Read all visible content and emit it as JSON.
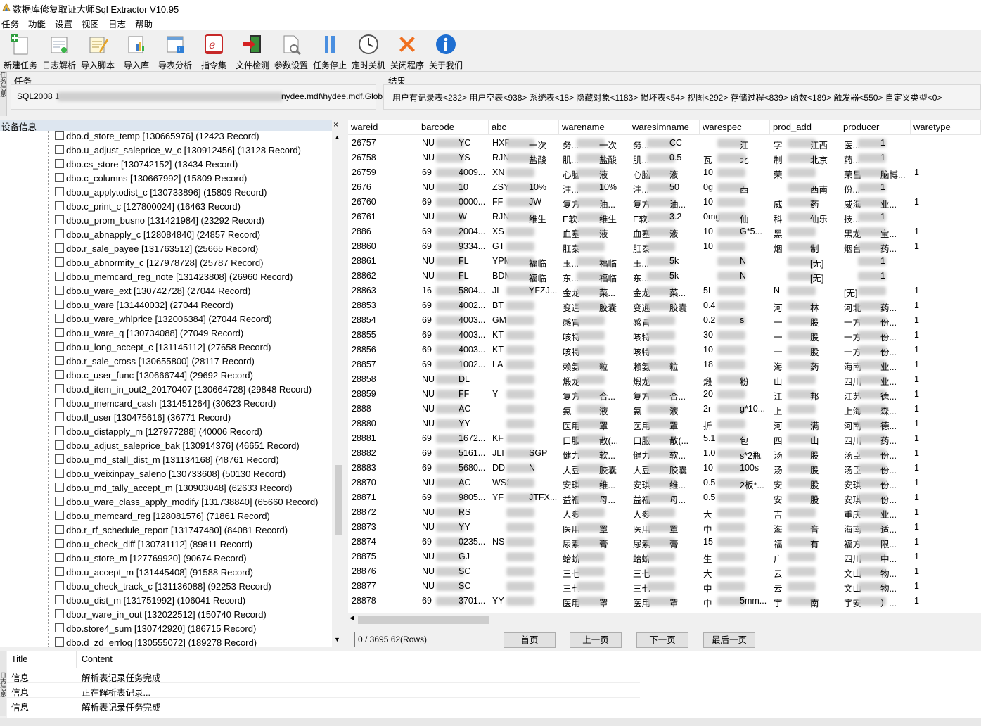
{
  "window": {
    "title": "数据库修复取证大师Sql Extractor V10.95"
  },
  "menu": [
    "任务",
    "功能",
    "设置",
    "视图",
    "日志",
    "帮助"
  ],
  "toolbar": [
    {
      "label": "新建任务",
      "icon": "new-task-icon"
    },
    {
      "label": "日志解析",
      "icon": "log-parse-icon"
    },
    {
      "label": "导入脚本",
      "icon": "import-script-icon"
    },
    {
      "label": "导入库",
      "icon": "import-db-icon"
    },
    {
      "label": "导表分析",
      "icon": "table-analysis-icon"
    },
    {
      "label": "指令集",
      "icon": "command-set-icon"
    },
    {
      "label": "文件检测",
      "icon": "file-check-icon"
    },
    {
      "label": "参数设置",
      "icon": "param-settings-icon"
    },
    {
      "label": "任务停止",
      "icon": "pause-icon"
    },
    {
      "label": "定时关机",
      "icon": "clock-icon"
    },
    {
      "label": "关闭程序",
      "icon": "close-icon"
    },
    {
      "label": "关于我们",
      "icon": "info-icon"
    }
  ],
  "side_tabs": {
    "task": "任务信息",
    "log": "日志信息"
  },
  "task": {
    "header": "任务",
    "prefix": "SQL2008 1",
    "path_tail": "nydee.mdf\\hydee.mdf.Glob"
  },
  "result": {
    "header": "结果",
    "summary": "用户有记录表<232> 用户空表<938> 系统表<18> 隐藏对象<1183> 损坏表<54> 视图<292> 存储过程<839> 函数<189> 触发器<550> 自定义类型<0>"
  },
  "device": {
    "title": "设备信息",
    "tables": [
      "dbo.d_store_temp [130665976] (12423 Record)",
      "dbo.u_adjust_saleprice_w_c [130912456] (13128 Record)",
      "dbo.cs_store [130742152] (13434 Record)",
      "dbo.c_columns [130667992] (15809 Record)",
      "dbo.u_applytodist_c [130733896] (15809 Record)",
      "dbo.c_print_c [127800024] (16463 Record)",
      "dbo.u_prom_busno [131421984] (23292 Record)",
      "dbo.u_abnapply_c [128084840] (24857 Record)",
      "dbo.r_sale_payee [131763512] (25665 Record)",
      "dbo.u_abnormity_c [127978728] (25787 Record)",
      "dbo.u_memcard_reg_note [131423808] (26960 Record)",
      "dbo.u_ware_ext [130742728] (27044 Record)",
      "dbo.u_ware [131440032] (27044 Record)",
      "dbo.u_ware_whlprice [132006384] (27044 Record)",
      "dbo.u_ware_q [130734088] (27049 Record)",
      "dbo.u_long_accept_c [131145112] (27658 Record)",
      "dbo.r_sale_cross [130655800] (28117 Record)",
      "dbo.c_user_func [130666744] (29692 Record)",
      "dbo.d_item_in_out2_20170407 [130664728] (29848 Record)",
      "dbo.u_memcard_cash [131451264] (30623 Record)",
      "dbo.tl_user [130475616] (36771 Record)",
      "dbo.u_distapply_m [127977288] (40006 Record)",
      "dbo.u_adjust_saleprice_bak [130914376] (46651 Record)",
      "dbo.u_md_stall_dist_m [131134168] (48761 Record)",
      "dbo.u_weixinpay_saleno [130733608] (50130 Record)",
      "dbo.u_md_tally_accept_m [130903048] (62633 Record)",
      "dbo.u_ware_class_apply_modify [131738840] (65660 Record)",
      "dbo.u_memcard_reg [128081576] (71861 Record)",
      "dbo.r_rf_schedule_report [131747480] (84081 Record)",
      "dbo.u_check_diff [130731112] (89811 Record)",
      "dbo.u_store_m [127769920] (90674 Record)",
      "dbo.u_accept_m [131445408] (91588 Record)",
      "dbo.u_check_track_c [131136088] (92253 Record)",
      "dbo.u_dist_m [131751992] (106041 Record)",
      "dbo.r_ware_in_out [132022512] (150740 Record)",
      "dbo.store4_sum [130742920] (186715 Record)",
      "dbo.d_zd_errlog [130555072] (189278 Record)"
    ]
  },
  "grid": {
    "columns": [
      "wareid",
      "barcode",
      "abc",
      "warename",
      "waresimname",
      "warespec",
      "prod_add",
      "producer",
      "waretype"
    ],
    "rows": [
      [
        "26757",
        "NU",
        "YC",
        "HXR...",
        "一次",
        "务...",
        "一次",
        "务...",
        "CC",
        "",
        "江",
        "字",
        "江西",
        "医...",
        "1"
      ],
      [
        "26758",
        "NU",
        "YS",
        "RJNJ...",
        "盐酸",
        "肌...",
        "盐酸",
        "肌...",
        "0.5",
        "瓦",
        "北",
        "制",
        "北京",
        "药...",
        "1"
      ],
      [
        "26759",
        "69",
        "4009...",
        "XN",
        "",
        "心脑",
        "液",
        "心脑",
        "液",
        "10",
        "",
        "荣",
        "",
        "荣昌",
        "脑博...",
        "1"
      ],
      [
        "2676",
        "NU",
        "10",
        "ZSY(B...",
        "10%",
        "注...",
        "10%",
        "注...",
        "50",
        "0g",
        "西",
        "",
        "西南",
        "份...",
        "1"
      ],
      [
        "26760",
        "69",
        "0000...",
        "FF",
        "JW",
        "复方",
        "油...",
        "复方",
        "油...",
        "10",
        "",
        "威",
        "药",
        "威海",
        "业...",
        "1"
      ],
      [
        "26761",
        "NU",
        "W",
        "RJN",
        "维生",
        "E软...",
        "维生",
        "E软...",
        "3.2",
        "0mg...",
        "仙",
        "科",
        "仙乐",
        "技...",
        "1"
      ],
      [
        "2886",
        "69",
        "2004...",
        "XS",
        "",
        "血塞",
        "液",
        "血塞",
        "液",
        "10",
        "G*5...",
        "黑",
        "",
        "黑龙",
        "宝...",
        "1"
      ],
      [
        "28860",
        "69",
        "9334...",
        "GT",
        "",
        "肛泰",
        "",
        "肛泰",
        "",
        "10",
        "",
        "烟",
        "制",
        "烟台",
        "药...",
        "1"
      ],
      [
        "28861",
        "NU",
        "FL",
        "YPML...",
        "福临",
        "玉...",
        "福临",
        "玉...",
        "5k",
        "",
        "N",
        "",
        "[无]",
        "",
        "1"
      ],
      [
        "28862",
        "NU",
        "FL",
        "BDM",
        "福临",
        "东...",
        "福临",
        "东...",
        "5k",
        "",
        "N",
        "",
        "[无]",
        "",
        "1"
      ],
      [
        "28863",
        "16",
        "5804...",
        "JL",
        "YFZJ...",
        "金龙",
        "菜...",
        "金龙",
        "菜...",
        "5L",
        "",
        "N",
        "",
        "[无]",
        "",
        "1"
      ],
      [
        "28853",
        "69",
        "4002...",
        "BT",
        "",
        "变通",
        "胶囊",
        "变通",
        "胶囊",
        "0.4",
        "",
        "河",
        "林",
        "河北",
        "药...",
        "1"
      ],
      [
        "28854",
        "69",
        "4003...",
        "GM",
        "",
        "感冒",
        "",
        "感冒",
        "",
        "0.2",
        "s",
        "一",
        "股",
        "一方",
        "份...",
        "1"
      ],
      [
        "28855",
        "69",
        "4003...",
        "KT",
        "",
        "咳特",
        "",
        "咳特",
        "",
        "30",
        "",
        "一",
        "股",
        "一方",
        "份...",
        "1"
      ],
      [
        "28856",
        "69",
        "4003...",
        "KT",
        "",
        "咳特",
        "",
        "咳特",
        "",
        "10",
        "",
        "一",
        "股",
        "一方",
        "份...",
        "1"
      ],
      [
        "28857",
        "69",
        "1002...",
        "LA",
        "",
        "赖氨",
        "粒",
        "赖氨",
        "粒",
        "18",
        "",
        "海",
        "药",
        "海南",
        "业...",
        "1"
      ],
      [
        "28858",
        "NU",
        "DL",
        "",
        "",
        "煅龙",
        "",
        "煅龙",
        "",
        "煅",
        "粉",
        "山",
        "",
        "四川",
        "业...",
        "1"
      ],
      [
        "28859",
        "NU",
        "FF",
        "Y",
        "",
        "复方",
        "合...",
        "复方",
        "合...",
        "20",
        "",
        "江",
        "邦",
        "江苏",
        "德...",
        "1"
      ],
      [
        "2888",
        "NU",
        "AC",
        "",
        "",
        "氨",
        "液",
        "氨",
        "液",
        "2r",
        "g*10...",
        "上",
        "",
        "上海",
        "森...",
        "1"
      ],
      [
        "28880",
        "NU",
        "YY",
        "",
        "",
        "医用",
        "罩",
        "医用",
        "罩",
        "折",
        "",
        "河",
        "满",
        "河南",
        "德...",
        "1"
      ],
      [
        "28881",
        "69",
        "1672...",
        "KF",
        "",
        "口服",
        "散(...",
        "口服",
        "散(...",
        "5.1",
        "包",
        "四",
        "山",
        "四川",
        "药...",
        "1"
      ],
      [
        "28882",
        "69",
        "5161...",
        "JLI",
        "SGP",
        "健力",
        "软...",
        "健力",
        "软...",
        "1.0",
        "s*2瓶",
        "汤",
        "股",
        "汤臣",
        "份...",
        "1"
      ],
      [
        "28883",
        "69",
        "5680...",
        "DD",
        "N",
        "大豆",
        "胶囊",
        "大豆",
        "胶囊",
        "10",
        "100s",
        "汤",
        "股",
        "汤臣",
        "份...",
        "1"
      ],
      [
        "28870",
        "NU",
        "AC",
        "WSSD...",
        "",
        "安琪",
        "维...",
        "安琪",
        "维...",
        "0.5",
        "2板*...",
        "安",
        "股",
        "安琪",
        "份...",
        "1"
      ],
      [
        "28871",
        "69",
        "9805...",
        "YF",
        "JTFX...",
        "益福",
        "母...",
        "益福",
        "母...",
        "0.5",
        "",
        "安",
        "股",
        "安琪",
        "份...",
        "1"
      ],
      [
        "28872",
        "NU",
        "RS",
        "",
        "",
        "人参",
        "",
        "人参",
        "",
        "大",
        "",
        "吉",
        "",
        "重庆",
        "业...",
        "1"
      ],
      [
        "28873",
        "NU",
        "YY",
        "",
        "",
        "医用",
        "罩",
        "医用",
        "罩",
        "中",
        "",
        "海",
        "音",
        "海南",
        "适...",
        "1"
      ],
      [
        "28874",
        "69",
        "0235...",
        "NS",
        "",
        "尿素",
        "膏",
        "尿素",
        "膏",
        "15",
        "",
        "福",
        "有",
        "福方",
        "限...",
        "1"
      ],
      [
        "28875",
        "NU",
        "GJ",
        "",
        "",
        "蛤蚧",
        "",
        "蛤蚧",
        "",
        "生",
        "",
        "广",
        "",
        "四川",
        "中...",
        "1"
      ],
      [
        "28876",
        "NU",
        "SC",
        "",
        "",
        "三七",
        "",
        "三七",
        "",
        "大",
        "",
        "云",
        "",
        "文山",
        "物...",
        "1"
      ],
      [
        "28877",
        "NU",
        "SC",
        "",
        "",
        "三七",
        "",
        "三七",
        "",
        "中",
        "",
        "云",
        "",
        "文山",
        "物...",
        "1"
      ],
      [
        "28878",
        "69",
        "3701...",
        "YY",
        "",
        "医用",
        "罩",
        "医用",
        "罩",
        "中",
        "5mm...",
        "宇",
        "南",
        "宇安",
        "）...",
        "1"
      ]
    ]
  },
  "pager": {
    "info": "0 / 3695  62(Rows)",
    "first": "首页",
    "prev": "上一页",
    "next": "下一页",
    "last": "最后一页"
  },
  "log": {
    "columns": [
      "Title",
      "Content"
    ],
    "rows": [
      {
        "title": "信息",
        "content": "解析表记录任务完成"
      },
      {
        "title": "信息",
        "content": "正在解析表记录..."
      },
      {
        "title": "信息",
        "content": "解析表记录任务完成"
      }
    ]
  }
}
